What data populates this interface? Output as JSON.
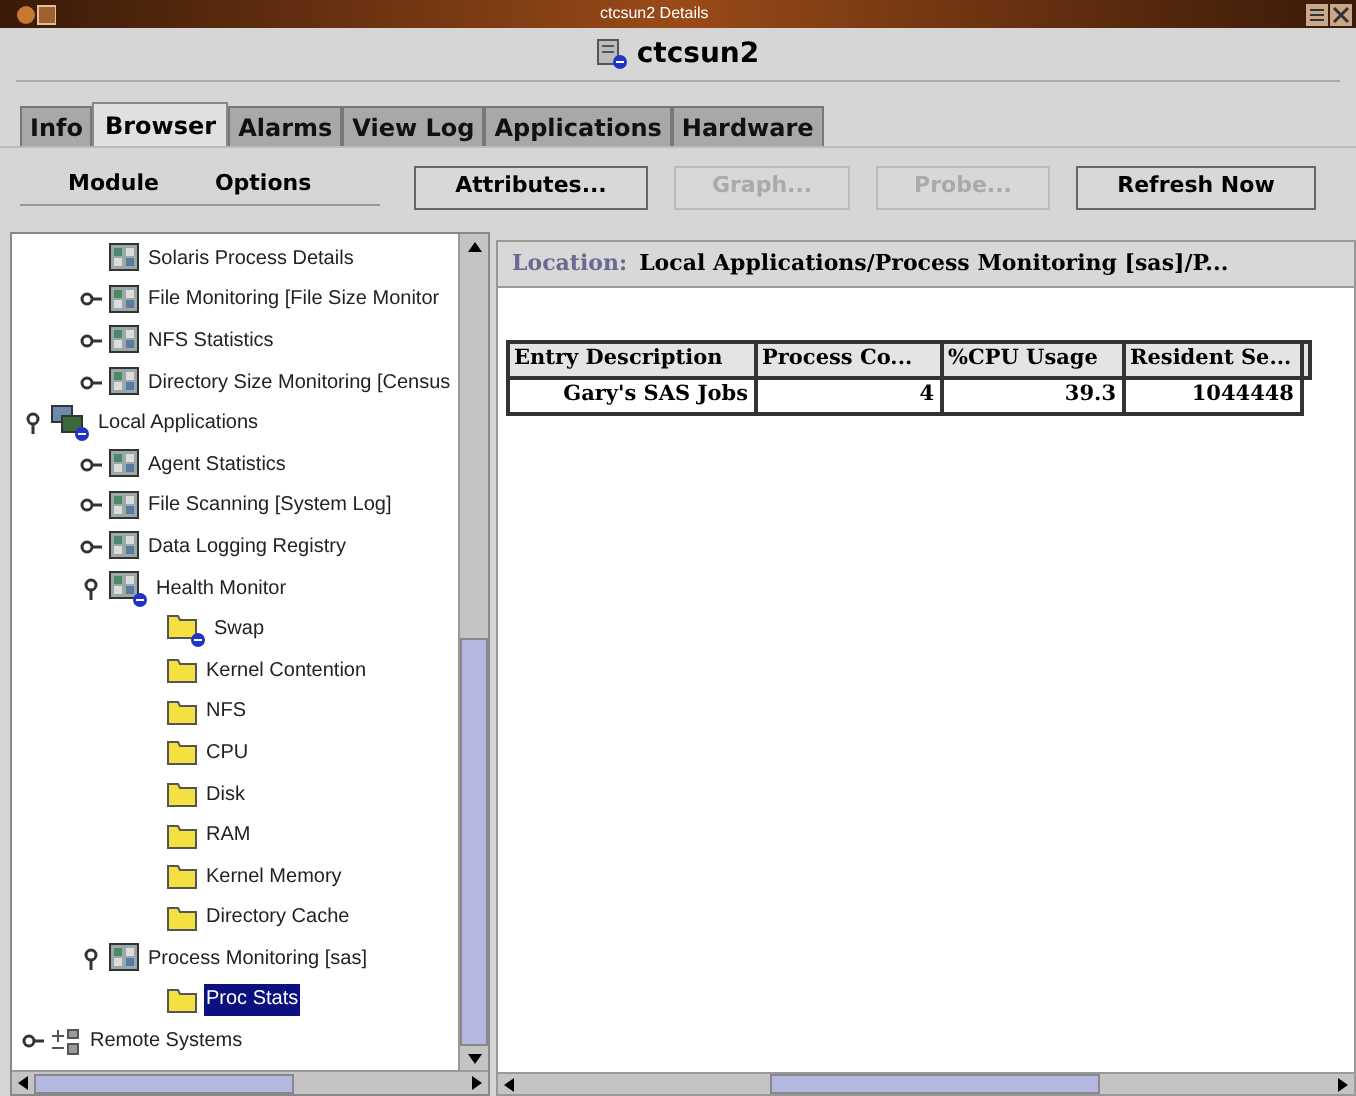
{
  "window": {
    "title": "ctcsun2 Details"
  },
  "header": {
    "host": "ctcsun2"
  },
  "tabs": [
    {
      "label": "Info",
      "selected": false
    },
    {
      "label": "Browser",
      "selected": true
    },
    {
      "label": "Alarms",
      "selected": false
    },
    {
      "label": "View Log",
      "selected": false
    },
    {
      "label": "Applications",
      "selected": false
    },
    {
      "label": "Hardware",
      "selected": false
    }
  ],
  "menus": [
    "Module",
    "Options"
  ],
  "buttons": [
    {
      "label": "Attributes...",
      "disabled": false
    },
    {
      "label": "Graph...",
      "disabled": true
    },
    {
      "label": "Probe...",
      "disabled": true
    },
    {
      "label": "Refresh Now",
      "disabled": false
    }
  ],
  "tree": {
    "items": [
      {
        "children": [
          {
            "label": "Solaris Process Details",
            "kind": "module",
            "flagged": false,
            "selected": false
          },
          {
            "label": "File Monitoring [File Size Monitor",
            "kind": "module",
            "expanded": false,
            "flagged": false,
            "selected": false
          },
          {
            "label": "NFS Statistics",
            "kind": "module",
            "expanded": false,
            "flagged": false,
            "selected": false
          },
          {
            "label": "Directory Size Monitoring [Census",
            "kind": "module",
            "expanded": false,
            "flagged": false,
            "selected": false
          }
        ]
      },
      {
        "label": "Local Applications",
        "kind": "host",
        "expanded": true,
        "flagged": true,
        "selected": false,
        "children": [
          {
            "label": "Agent Statistics",
            "kind": "module",
            "expanded": false,
            "flagged": false,
            "selected": false
          },
          {
            "label": "File Scanning [System Log]",
            "kind": "module",
            "expanded": false,
            "flagged": false,
            "selected": false
          },
          {
            "label": "Data Logging Registry",
            "kind": "module",
            "expanded": false,
            "flagged": false,
            "selected": false
          },
          {
            "label": "Health Monitor",
            "kind": "module",
            "expanded": true,
            "flagged": true,
            "selected": false,
            "children": [
              {
                "label": "Swap",
                "kind": "folder",
                "flagged": true,
                "selected": false
              },
              {
                "label": "Kernel Contention",
                "kind": "folder",
                "flagged": false,
                "selected": false
              },
              {
                "label": "NFS",
                "kind": "folder",
                "flagged": false,
                "selected": false
              },
              {
                "label": "CPU",
                "kind": "folder",
                "flagged": false,
                "selected": false
              },
              {
                "label": "Disk",
                "kind": "folder",
                "flagged": false,
                "selected": false
              },
              {
                "label": "RAM",
                "kind": "folder",
                "flagged": false,
                "selected": false
              },
              {
                "label": "Kernel Memory",
                "kind": "folder",
                "flagged": false,
                "selected": false
              },
              {
                "label": "Directory Cache",
                "kind": "folder",
                "flagged": false,
                "selected": false
              }
            ]
          },
          {
            "label": "Process Monitoring [sas]",
            "kind": "module",
            "expanded": true,
            "flagged": false,
            "selected": false,
            "children": [
              {
                "label": "Proc Stats",
                "kind": "folder",
                "flagged": false,
                "selected": true
              }
            ]
          }
        ]
      },
      {
        "label": "Remote Systems",
        "kind": "remote",
        "expanded": false,
        "flagged": false,
        "selected": false
      }
    ]
  },
  "location": {
    "label": "Location:",
    "path": "Local Applications/Process Monitoring [sas]/P..."
  },
  "table": {
    "columns": [
      "Entry Description",
      "Process Co...",
      "%CPU Usage",
      "Resident Se..."
    ],
    "rows": [
      [
        "Gary's SAS Jobs",
        "4",
        "39.3",
        "1044448"
      ]
    ]
  }
}
